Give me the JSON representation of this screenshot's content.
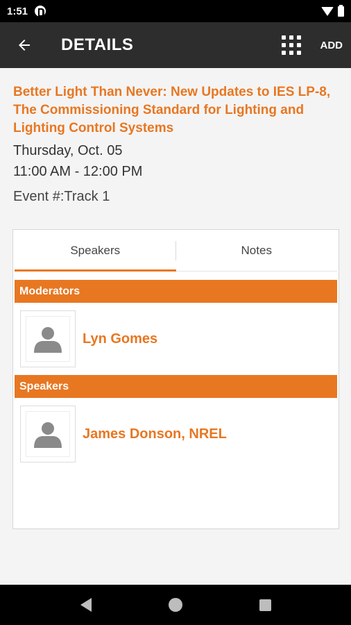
{
  "status_bar": {
    "time": "1:51"
  },
  "app_bar": {
    "title": "DETAILS",
    "add_label": "ADD"
  },
  "event": {
    "title": "Better Light Than Never: New Updates to IES LP-8, The Commissioning Standard for Lighting and Lighting Control Systems",
    "date": "Thursday, Oct. 05",
    "time": "11:00 AM - 12:00 PM",
    "track": "Event #:Track 1"
  },
  "tabs": [
    {
      "label": "Speakers",
      "active": true
    },
    {
      "label": "Notes",
      "active": false
    }
  ],
  "sections": [
    {
      "header": "Moderators",
      "people": [
        {
          "name": "Lyn Gomes"
        }
      ]
    },
    {
      "header": "Speakers",
      "people": [
        {
          "name": "James Donson, NREL"
        }
      ]
    }
  ],
  "colors": {
    "accent": "#e87722",
    "app_bar": "#2d2d2d"
  },
  "icons": {
    "back": "arrow-left-icon",
    "grid": "grid-icon",
    "avatar": "person-placeholder-icon"
  }
}
